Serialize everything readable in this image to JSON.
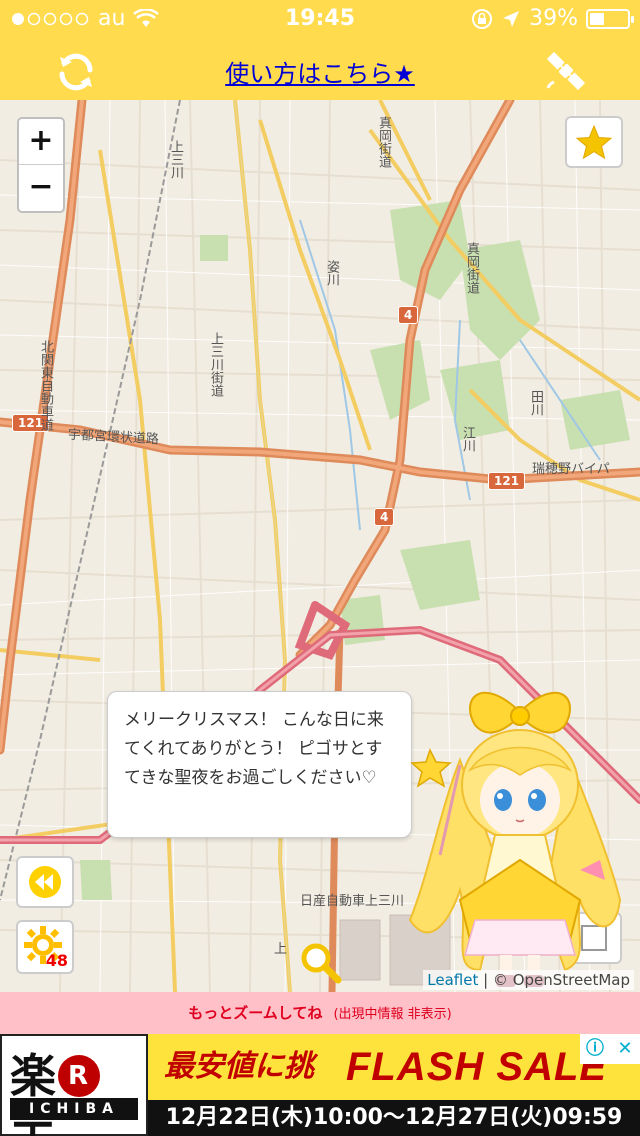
{
  "status_bar": {
    "carrier": "au",
    "time": "19:45",
    "battery": "39%",
    "battery_level": 0.39,
    "signal_icon": "signal-dots-icon",
    "wifi_icon": "wifi-icon"
  },
  "header": {
    "howto_link": "使い方はこちら★",
    "refresh_icon": "refresh-icon",
    "satellite_icon": "satellite-icon",
    "background_color": "#ffdb4d"
  },
  "map": {
    "zoom_in": "+",
    "zoom_out": "−",
    "labels": {
      "route_121_left": "121",
      "route_121_right": "121",
      "route_4_top": "4",
      "route_4_bottom": "4",
      "utsunomiya_ring": "宇都宮環状道路",
      "mizuhono_bypass": "瑞穂野バイパ",
      "moka_kaido_top": "真岡街道",
      "moka_kaido_right": "真岡街道",
      "kamisanokawa": "上三川",
      "kamisanokawa_kaido": "上三川街道",
      "sugata_river": "姿川",
      "tagawa": "田川",
      "egawa": "江川",
      "kita_kanto": "北関東自動車道",
      "nissan": "日産自動車上三川",
      "kami": "上",
      "kami2": "上三"
    },
    "speech_bubble": "メリークリスマス！ こんな日に来てくれてありがとう！ ピゴサとすてきな聖夜をお過ごしください♡",
    "attribution_leaflet": "Leaflet",
    "attribution_osm": "| © OpenStreetMap",
    "sun_count": "48",
    "buttons": {
      "favorite_icon": "star-icon",
      "rewind_icon": "rewind-icon",
      "weather_icon": "sun-gear-icon",
      "search_icon": "magnifier-icon",
      "square_icon": "square-icon"
    }
  },
  "notice": {
    "main": "もっとズームしてね",
    "sub": "(出現中情報 非表示)"
  },
  "ad": {
    "logo_main_left": "楽",
    "logo_r": "R",
    "logo_main_right": "天",
    "logo_sub": "ICHIBA",
    "tagline": "最安値に挑戦",
    "headline": "FLASH SALE",
    "dates": "12月22日(木)10:00〜12月27日(火)09:59",
    "info_icon": "ⓘ",
    "close_icon": "✕"
  }
}
